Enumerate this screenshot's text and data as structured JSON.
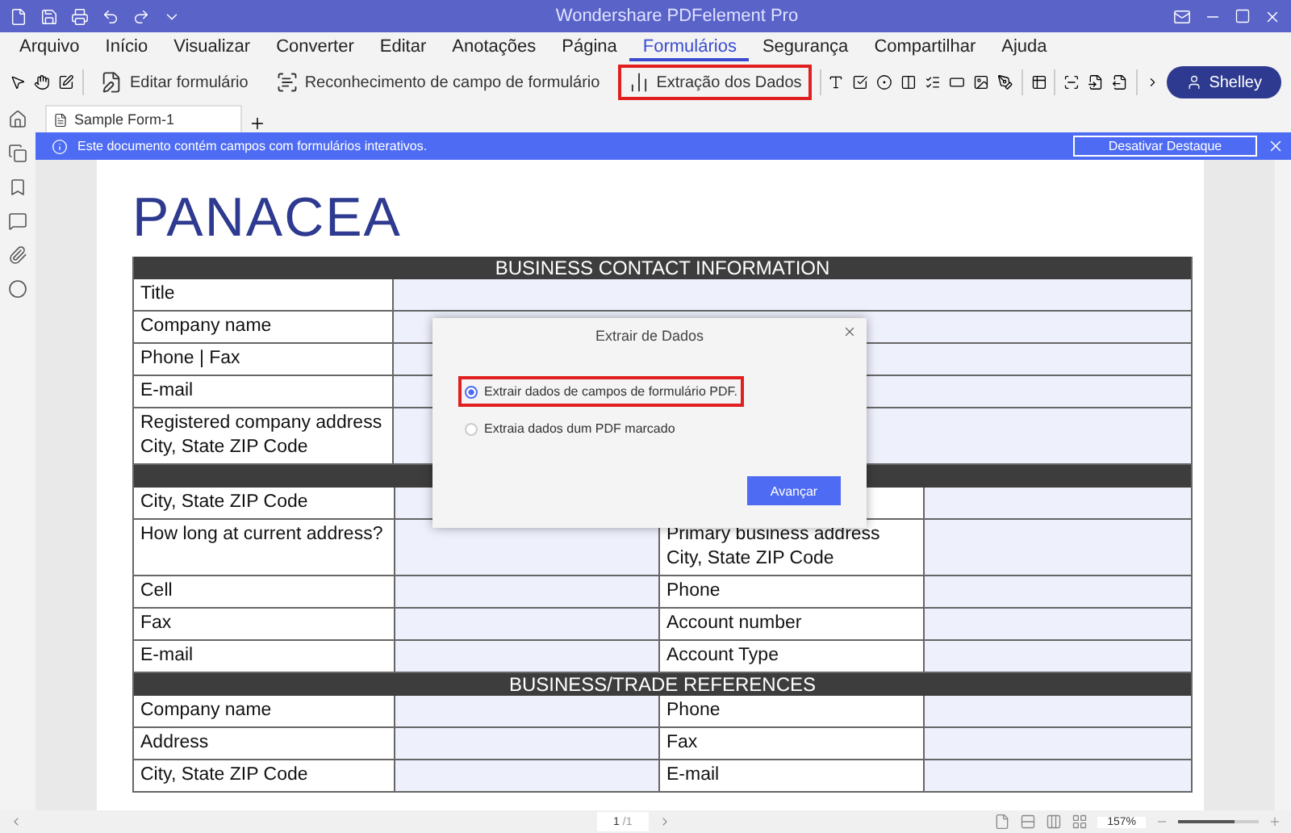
{
  "window": {
    "title": "Wondershare PDFelement Pro"
  },
  "menu": [
    {
      "label": "Arquivo",
      "selected": false
    },
    {
      "label": "Início",
      "selected": false
    },
    {
      "label": "Visualizar",
      "selected": false
    },
    {
      "label": "Converter",
      "selected": false
    },
    {
      "label": "Editar",
      "selected": false
    },
    {
      "label": "Anotações",
      "selected": false
    },
    {
      "label": "Página",
      "selected": false
    },
    {
      "label": "Formulários",
      "selected": true
    },
    {
      "label": "Segurança",
      "selected": false
    },
    {
      "label": "Compartilhar",
      "selected": false
    },
    {
      "label": "Ajuda",
      "selected": false
    }
  ],
  "toolbar": {
    "buttons": [
      {
        "label": "Editar formulário",
        "highlighted": false
      },
      {
        "label": "Reconhecimento de campo de formulário",
        "highlighted": false
      },
      {
        "label": "Extração dos Dados",
        "highlighted": true
      }
    ],
    "user": "Shelley"
  },
  "tabs": [
    {
      "label": "Sample Form-1",
      "selected": true
    }
  ],
  "notice": {
    "text": "Este documento contém campos com formulários interativos.",
    "button": "Desativar Destaque"
  },
  "document": {
    "heading": "PANACEA",
    "sections": [
      {
        "kind": "wide",
        "title": "BUSINESS CONTACT INFORMATION",
        "rows": [
          {
            "label": "Title"
          },
          {
            "label": "Company name"
          },
          {
            "label": "Phone | Fax"
          },
          {
            "label": "E-mail"
          },
          {
            "label": "Registered company address\nCity, State ZIP Code"
          }
        ]
      },
      {
        "kind": "split",
        "rows": [
          {
            "left": "City, State ZIP Code"
          },
          {
            "left": "How long at current address?",
            "right": "Primary business address\nCity, State ZIP Code"
          },
          {
            "left": "Cell",
            "right": "Phone"
          },
          {
            "left": "Fax",
            "right": "Account number"
          },
          {
            "left": "E-mail",
            "right": "Account Type"
          }
        ]
      },
      {
        "kind": "split",
        "title": "BUSINESS/TRADE REFERENCES",
        "rows": [
          {
            "left": "Company name",
            "right": "Phone"
          },
          {
            "left": "Address",
            "right": "Fax"
          },
          {
            "left": "City, State ZIP Code",
            "right": "E-mail"
          }
        ]
      }
    ]
  },
  "dialog": {
    "title": "Extrair de Dados",
    "options": [
      {
        "label": "Extrair dados de campos de formulário PDF.",
        "selected": true,
        "highlighted": true
      },
      {
        "label": "Extraia dados dum PDF marcado",
        "selected": false,
        "highlighted": false
      }
    ],
    "button": "Avançar"
  },
  "status_bar": {
    "page": "1",
    "total": "/1",
    "zoom": "157%",
    "zoom_slider": {
      "level": 0.7
    }
  }
}
